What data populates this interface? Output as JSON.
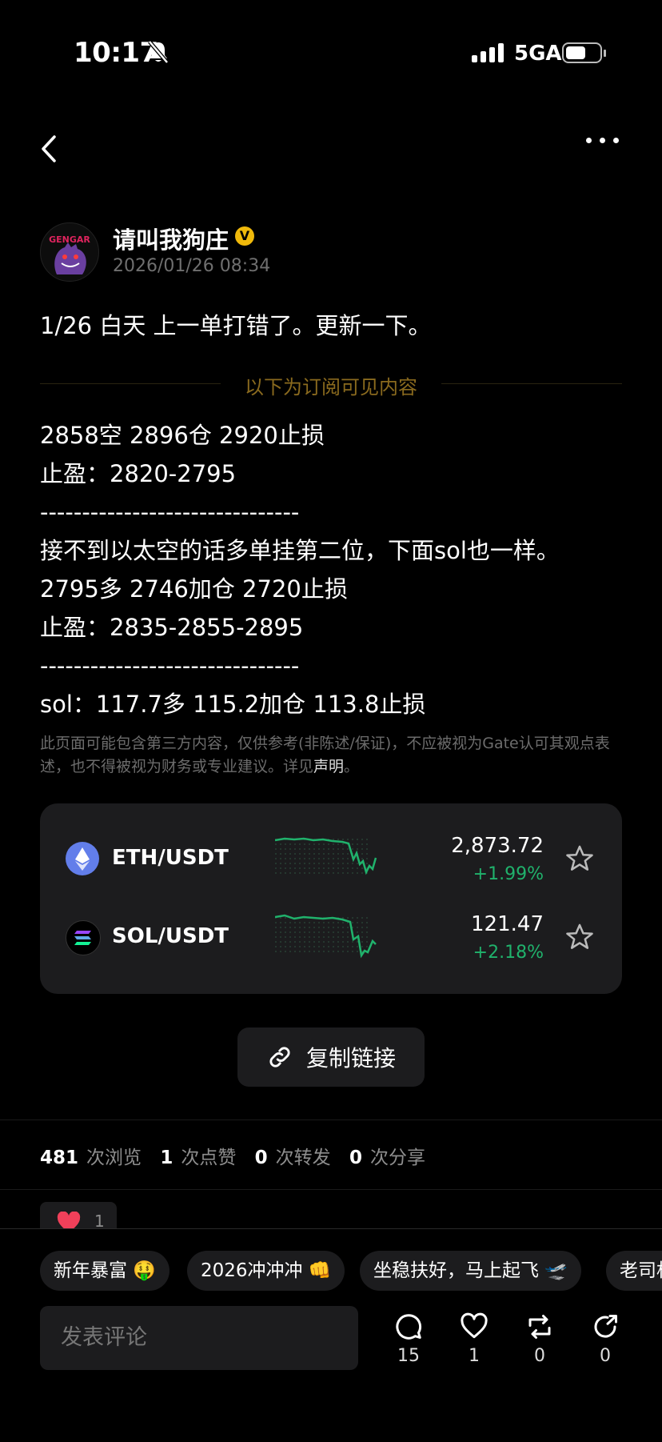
{
  "status": {
    "time": "10:17",
    "network": "5GA"
  },
  "author": {
    "name": "请叫我狗庄",
    "verified_mark": "V",
    "timestamp": "2026/01/26 08:34",
    "avatar_text": "GENGAR"
  },
  "post": {
    "intro": "1/26 白天 上一单打错了。更新一下。",
    "subscriber_divider": "以下为订阅可见内容",
    "lines": [
      "2858空 2896仓 2920止损",
      "止盈：2820-2795",
      "-------------------------------",
      "接不到以太空的话多单挂第二位，下面sol也一样。",
      "2795多 2746加仓 2720止损",
      "止盈：2835-2855-2895",
      "-------------------------------",
      "sol：117.7多 115.2加仓 113.8止损"
    ],
    "disclaimer": "此页面可能包含第三方内容，仅供参考(非陈述/保证)，不应被视为Gate认可其观点表述，也不得被视为财务或专业建议。详见",
    "disclaimer_link": "声明",
    "disclaimer_end": "。"
  },
  "markets": [
    {
      "pair": "ETH/USDT",
      "price": "2,873.72",
      "change": "+1.99%",
      "icon": "ethereum-icon",
      "color": "#627eea"
    },
    {
      "pair": "SOL/USDT",
      "price": "121.47",
      "change": "+2.18%",
      "icon": "solana-icon",
      "color": "#000000"
    }
  ],
  "copy_link_label": "复制链接",
  "stats": {
    "views": "481",
    "views_label": "次浏览",
    "likes": "1",
    "likes_label": "次点赞",
    "reposts": "0",
    "reposts_label": "次转发",
    "shares": "0",
    "shares_label": "次分享"
  },
  "reaction": {
    "emoji": "heart-icon",
    "count": "1"
  },
  "chips": [
    "新年暴富 🤑",
    "2026冲冲冲 👊",
    "坐稳扶好，马上起飞 🛫",
    "老司机"
  ],
  "comment_placeholder": "发表评论",
  "actions": {
    "comments": "15",
    "likes": "1",
    "reposts": "0",
    "shares": "0"
  },
  "colors": {
    "accent_gold": "#f0b90b",
    "positive": "#20b26c",
    "card": "#1c1c1e"
  }
}
